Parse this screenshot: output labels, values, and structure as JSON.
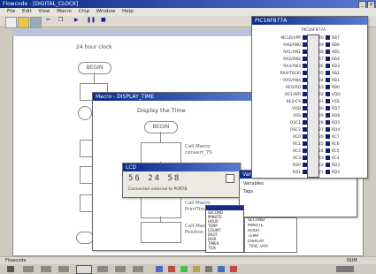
{
  "app": {
    "title": "Flowcode - [DIGITAL_CLOCK]"
  },
  "menu": [
    "File",
    "Edit",
    "View",
    "Macro",
    "Chip",
    "Window",
    "Help"
  ],
  "flowchart": {
    "note": "24 hour clock",
    "begin": "BEGIN"
  },
  "macro_window": {
    "title": "Macro - DISPLAY_TIME",
    "heading": "Display the Time",
    "begin": "BEGIN",
    "call1": [
      "Call Macro",
      "convert_7S"
    ],
    "call2": [
      "Call Macro",
      "PrintTime"
    ],
    "call3": [
      "Call Macro",
      "Position"
    ],
    "end": "END"
  },
  "lcd_window": {
    "title": "LCD",
    "time_display": "56 24 58",
    "status": "Connected external to PORTB"
  },
  "pin_window": {
    "title": "PIC16F877A",
    "chip_label": "PIC16F877A",
    "left_pins": [
      "MCLR/VPP",
      "RA0/AN0",
      "RA1/AN1",
      "RA2/AN2",
      "RA3/AN3",
      "RA4/T0CKI",
      "RA5/AN4",
      "RE0/RD",
      "RE1/WR",
      "RE2/CS",
      "VDD",
      "VSS",
      "OSC1",
      "OSC2",
      "RC0",
      "RC1",
      "RC2",
      "RC3",
      "RD0",
      "RD1"
    ],
    "right_pins": [
      "RB7",
      "RB6",
      "RB5",
      "RB4",
      "RB3",
      "RB2",
      "RB1",
      "RB0",
      "VDD",
      "VSS",
      "RD7",
      "RD6",
      "RD5",
      "RD4",
      "RC7",
      "RC6",
      "RC5",
      "RC4",
      "RD3",
      "RD2"
    ],
    "right_nums": [
      "40",
      "39",
      "38",
      "37",
      "36",
      "35",
      "34",
      "33",
      "32",
      "31",
      "30",
      "29",
      "28",
      "27",
      "26",
      "25",
      "24",
      "23",
      "22",
      "21"
    ]
  },
  "variables_window": {
    "title": "Variables",
    "heading": "Variables",
    "item": "Tags"
  },
  "dropdown": {
    "items": [
      "SECOND",
      "MINUTE",
      "HOUR",
      "TEMP",
      "COUNT",
      "DIGIT",
      "DISP",
      "TIMER",
      "TICK"
    ]
  },
  "list_panel": {
    "items": [
      "SECOND",
      "MINUTE",
      "HOUR",
      "TEMP",
      "DISPLAY"
    ],
    "footer": "TIME_VAR"
  },
  "status_bar": {
    "left": "Flowcode",
    "right": "NUM"
  },
  "colors": {
    "titlebar": "#0a2a8a",
    "desktop": "#cfcac0",
    "pin": "#1a1a6a"
  }
}
